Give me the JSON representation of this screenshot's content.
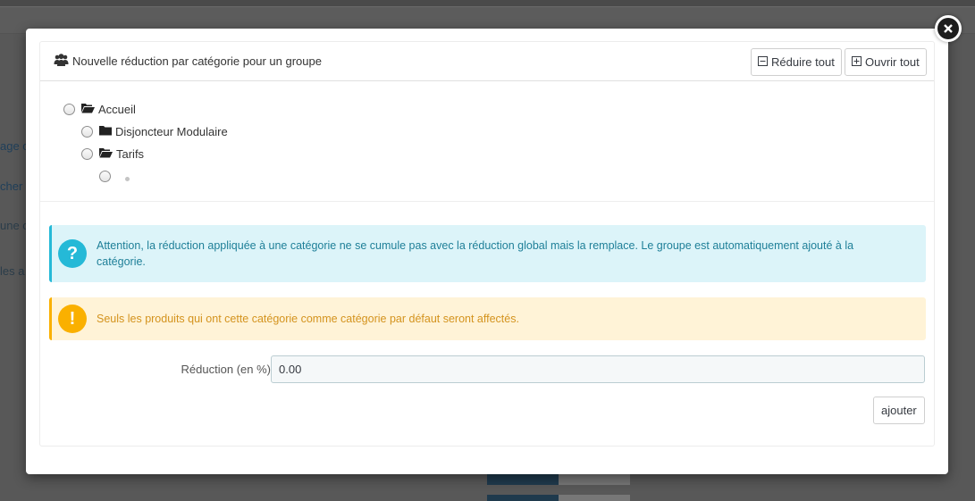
{
  "background": {
    "fragments": [
      "age c",
      "cher",
      "une c",
      "les a"
    ]
  },
  "modal": {
    "title": "Nouvelle réduction par catégorie pour un groupe",
    "title_icon": "users-icon",
    "collapse_all_label": "Réduire tout",
    "expand_all_label": "Ouvrir tout",
    "tree": [
      {
        "label": "Accueil",
        "icon": "folder-open-icon",
        "depth": 0
      },
      {
        "label": "Disjoncteur Modulaire",
        "icon": "folder-icon",
        "depth": 1
      },
      {
        "label": "Tarifs",
        "icon": "folder-open-icon",
        "depth": 1
      },
      {
        "label": "",
        "icon": "dot-icon",
        "depth": 2
      }
    ],
    "info_alert": "Attention, la réduction appliquée à une catégorie ne se cumule pas avec la réduction global mais la remplace. Le groupe est automatiquement ajouté à la catégorie.",
    "warning_alert": "Seuls les produits qui ont cette catégorie comme catégorie par défaut seront affectés.",
    "reduction_label": "Réduction (en %)",
    "reduction_value": "0.00",
    "submit_label": "ajouter"
  },
  "colors": {
    "info": "#25b9d7",
    "warning": "#fab000",
    "info_bg": "#dcf4f9",
    "warning_bg": "#fff3d7"
  }
}
